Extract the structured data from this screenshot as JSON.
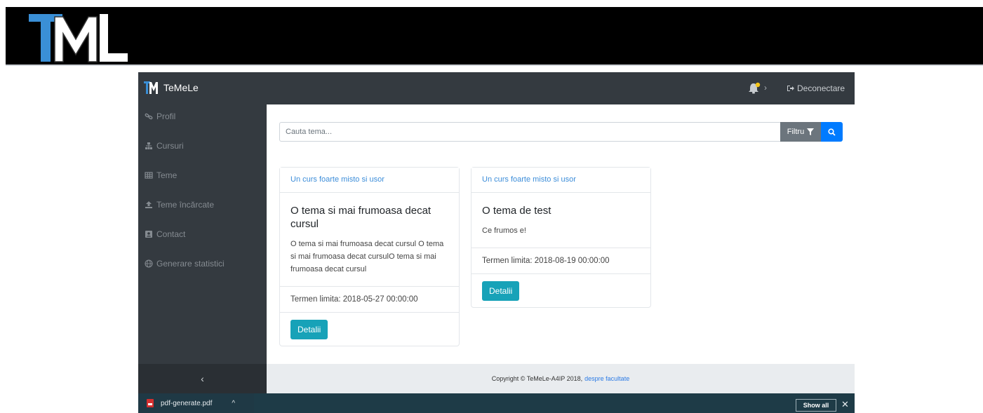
{
  "banner": {
    "logo_icon": "tml-logo-icon"
  },
  "app": {
    "brand": "TeMeLe",
    "navbar": {
      "notification_icon": "bell-icon",
      "notification_dot_color": "#f5c518",
      "logout_label": "Deconectare",
      "logout_icon": "sign-out-icon"
    },
    "sidebar": {
      "items": [
        {
          "label": "Profil",
          "icon": "link-icon"
        },
        {
          "label": "Cursuri",
          "icon": "sitemap-icon"
        },
        {
          "label": "Teme",
          "icon": "table-icon"
        },
        {
          "label": "Teme încărcate",
          "icon": "upload-icon"
        },
        {
          "label": "Contact",
          "icon": "contact-card-icon"
        },
        {
          "label": "Generare statistici",
          "icon": "globe-icon"
        }
      ],
      "collapse_label": "‹"
    },
    "search": {
      "placeholder": "Cauta tema...",
      "filter_label": "Filtru",
      "filter_icon": "filter-icon",
      "search_icon": "search-icon"
    },
    "cards": [
      {
        "course": "Un curs foarte misto si usor",
        "title": "O tema si mai frumoasa decat cursul",
        "description": "O tema si mai frumoasa decat cursul O tema si mai frumoasa decat cursulO tema si mai frumoasa decat cursul",
        "deadline": "Termen limita: 2018-05-27 00:00:00",
        "button": "Detalii"
      },
      {
        "course": "Un curs foarte misto si usor",
        "title": "O tema de test",
        "description": "Ce frumos e!",
        "deadline": "Termen limita: 2018-08-19 00:00:00",
        "button": "Detalii"
      }
    ],
    "footer": {
      "text": "Copyright © TeMeLe-A4IP 2018,",
      "link": "despre facultate"
    },
    "accent": "#17a2b8",
    "primary": "#007bff"
  },
  "download_bar": {
    "file_name": "pdf-generate.pdf",
    "caret": "^",
    "show_all": "Show all",
    "close": "✕"
  }
}
